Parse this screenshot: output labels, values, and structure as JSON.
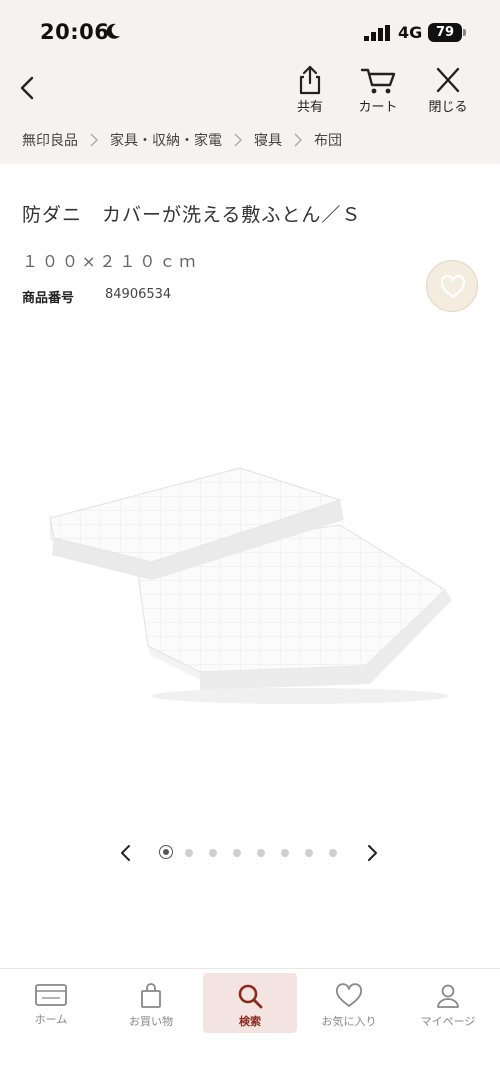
{
  "status_bar": {
    "time": "20:06",
    "network": "4G",
    "battery": "79"
  },
  "header": {
    "share_label": "共有",
    "cart_label": "カート",
    "close_label": "閉じる"
  },
  "breadcrumb": [
    "無印良品",
    "家具・収納・家電",
    "寝具",
    "布団"
  ],
  "product": {
    "title": "防ダニ　カバーが洗える敷ふとん／Ｓ",
    "size": "１００×２１０ｃｍ",
    "number_label": "商品番号",
    "number_value": "84906534"
  },
  "carousel": {
    "total": 8,
    "active_index": 0
  },
  "tab_bar": {
    "items": [
      {
        "label": "ホーム",
        "icon": "home-card-icon"
      },
      {
        "label": "お買い物",
        "icon": "shopping-bag-icon"
      },
      {
        "label": "検索",
        "icon": "search-icon"
      },
      {
        "label": "お気に入り",
        "icon": "heart-icon"
      },
      {
        "label": "マイページ",
        "icon": "person-icon"
      }
    ],
    "active": "検索"
  },
  "colors": {
    "header_bg": "#f4f3f1",
    "accent": "#8a2a1d",
    "active_tab_bg": "#f4e4e1",
    "favorite_bg": "#f3ecdf"
  }
}
